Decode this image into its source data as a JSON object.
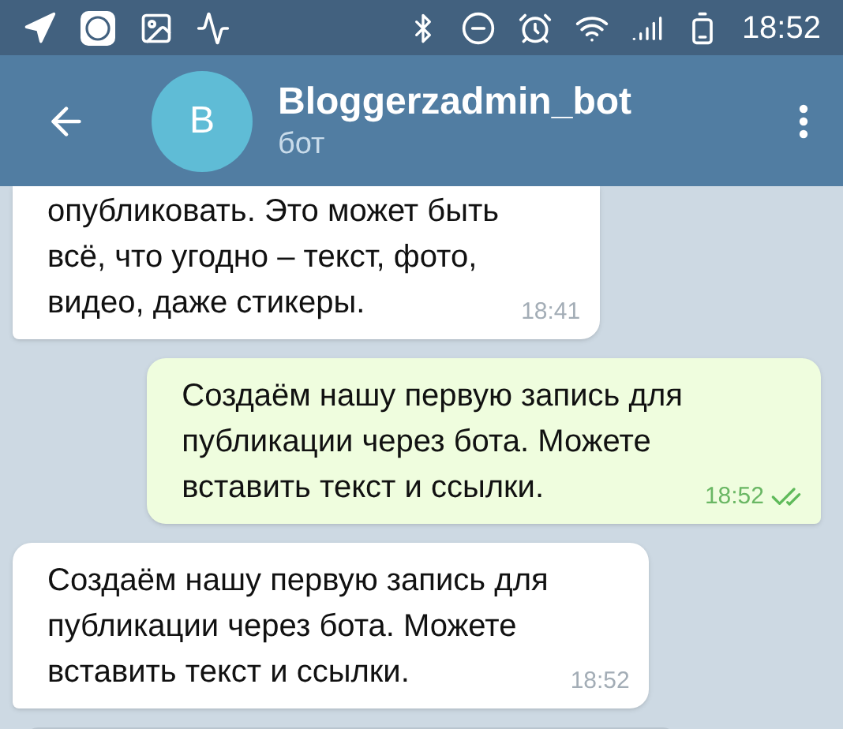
{
  "status_bar": {
    "time": "18:52"
  },
  "header": {
    "avatar_letter": "B",
    "title": "Bloggerzadmin_bot",
    "subtitle": "бот"
  },
  "messages": [
    {
      "kind": "incoming",
      "text": "опубликовать. Это может быть\nвсё, что угодно – текст, фото,\nвидео, даже стикеры.",
      "time": "18:41"
    },
    {
      "kind": "outgoing",
      "text": "Создаём нашу первую запись для\nпубликации через бота. Можете\nвставить текст и ссылки.",
      "time": "18:52",
      "read": true
    },
    {
      "kind": "incoming",
      "text": "Создаём нашу первую запись для\nпубликации через бота. Можете\nвставить текст и ссылки.",
      "time": "18:52"
    }
  ]
}
